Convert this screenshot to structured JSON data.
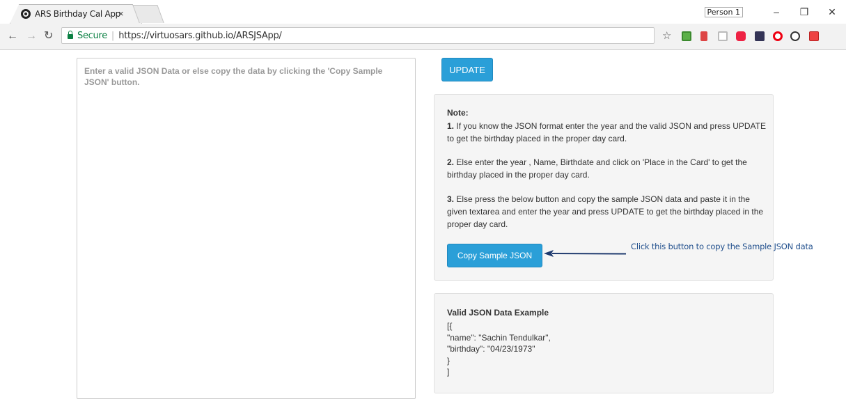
{
  "browser": {
    "tab_title": "ARS Birthday Cal App",
    "tab_close": "×",
    "profile_name": "Person 1",
    "url_secure_label": "Secure",
    "url": "https://virtuosars.github.io/ARSJSApp/",
    "extension_icons": [
      "pushbullet-icon",
      "bookmark-icon",
      "reader-icon",
      "pocket-icon",
      "window-icon",
      "opera-icon",
      "panda-icon",
      "rss-icon"
    ]
  },
  "main": {
    "json_placeholder": "Enter a valid JSON Data or else copy the data by clicking the 'Copy Sample JSON' button.",
    "update_label": "UPDATE",
    "note": {
      "heading": "Note:",
      "items": [
        {
          "num": "1.",
          "text": "If you know the JSON format enter the year and the valid JSON and press UPDATE to get the birthday placed in the proper day card."
        },
        {
          "num": "2.",
          "text": "Else enter the year , Name, Birthdate and click on 'Place in the Card' to get the birthday placed in the proper day card."
        },
        {
          "num": "3.",
          "text": "Else press the below button and copy the sample JSON data and paste it in the given textarea and enter the year and press UPDATE to get the birthday placed in the proper day card."
        }
      ],
      "copy_button_label": "Copy Sample JSON"
    },
    "annotation": "Click this button to copy the Sample JSON data",
    "example": {
      "heading": "Valid JSON Data Example",
      "lines": [
        "[{",
        "\"name\": \"Sachin Tendulkar\",",
        "\"birthday\": \"04/23/1973\"",
        "}",
        "]"
      ]
    }
  }
}
